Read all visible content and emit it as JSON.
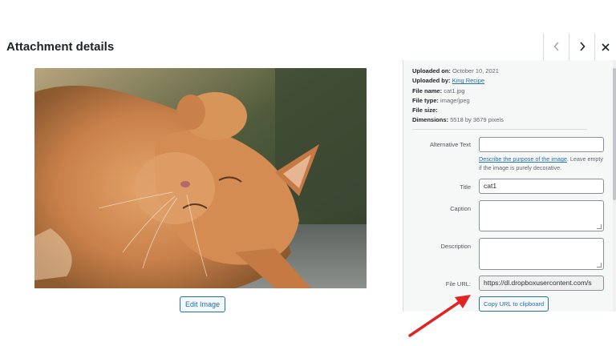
{
  "header": {
    "title": "Attachment details",
    "prev_icon": "chevron-left-icon",
    "next_icon": "chevron-right-icon",
    "close_icon": "close-icon"
  },
  "preview": {
    "edit_label": "Edit Image"
  },
  "details": {
    "uploaded_on_label": "Uploaded on:",
    "uploaded_on": "October 10, 2021",
    "uploaded_by_label": "Uploaded by:",
    "uploaded_by": "King Recipe",
    "file_name_label": "File name:",
    "file_name": "cat1.jpg",
    "file_type_label": "File type:",
    "file_type": "image/jpeg",
    "file_size_label": "File size:",
    "file_size": "",
    "dimensions_label": "Dimensions:",
    "dimensions": "5518 by 3679 pixels"
  },
  "form": {
    "alt_label": "Alternative Text",
    "alt_value": "",
    "alt_help_link": "Describe the purpose of the image",
    "alt_help_rest": ". Leave empty if the image is purely decorative.",
    "title_label": "Title",
    "title_value": "cat1",
    "caption_label": "Caption",
    "caption_value": "",
    "description_label": "Description",
    "description_value": "",
    "file_url_label": "File URL:",
    "file_url_value": "https://dl.dropboxusercontent.com/s",
    "copy_label": "Copy URL to clipboard"
  },
  "colors": {
    "accent": "#2271b1",
    "annotation_arrow": "#e02424"
  }
}
